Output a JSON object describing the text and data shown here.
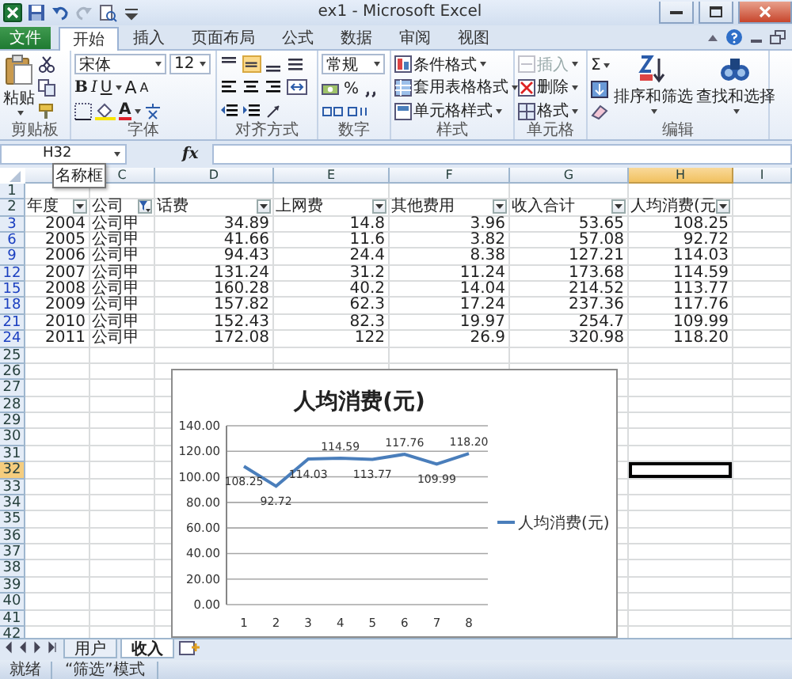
{
  "window": {
    "title": "ex1 - Microsoft Excel"
  },
  "ribbon_tabs": [
    {
      "label": "文件",
      "kind": "file",
      "selected": false
    },
    {
      "label": "开始",
      "kind": "tab",
      "selected": true
    },
    {
      "label": "插入",
      "kind": "tab",
      "selected": false
    },
    {
      "label": "页面布局",
      "kind": "tab",
      "selected": false
    },
    {
      "label": "公式",
      "kind": "tab",
      "selected": false
    },
    {
      "label": "数据",
      "kind": "tab",
      "selected": false
    },
    {
      "label": "审阅",
      "kind": "tab",
      "selected": false
    },
    {
      "label": "视图",
      "kind": "tab",
      "selected": false
    }
  ],
  "ribbon_groups": [
    {
      "kind": "clipboard",
      "label": "剪贴板",
      "paste": "粘贴"
    },
    {
      "kind": "font",
      "label": "字体",
      "font_name": "宋体",
      "font_size": "12",
      "style_buttons": [
        "B",
        "I",
        "U"
      ],
      "size_buttons": [
        "A",
        "A"
      ],
      "color_button": "A"
    },
    {
      "kind": "alignment",
      "label": "对齐方式"
    },
    {
      "kind": "number",
      "label": "数字",
      "format": "常规",
      "percent": "%"
    },
    {
      "kind": "styles",
      "label": "样式",
      "items": [
        "条件格式",
        "套用表格格式",
        "单元格样式"
      ]
    },
    {
      "kind": "cells",
      "label": "单元格",
      "items": [
        {
          "label": "插入",
          "disabled": true
        },
        {
          "label": "删除",
          "disabled": false
        },
        {
          "label": "格式",
          "disabled": false
        }
      ]
    },
    {
      "kind": "editing",
      "label": "编辑",
      "sum": "Σ",
      "items": [
        "排序和筛选",
        "查找和选择"
      ]
    }
  ],
  "formula_bar": {
    "name_box": "H32",
    "tooltip": "名称框",
    "fx": "fx"
  },
  "sheet": {
    "columns": [
      {
        "selected": false
      },
      {
        "label": "C",
        "selected": false
      },
      {
        "label": "D",
        "selected": false
      },
      {
        "label": "E",
        "selected": false
      },
      {
        "label": "F",
        "selected": false
      },
      {
        "label": "G",
        "selected": false
      },
      {
        "label": "H",
        "selected": true
      },
      {
        "label": "I",
        "selected": false
      }
    ],
    "rows": [
      {
        "number": "1",
        "kind": "blank",
        "filtered": false,
        "selected": false
      },
      {
        "number": "2",
        "kind": "header",
        "filtered": false,
        "selected": false,
        "cells": [
          {
            "text": "年度",
            "filter_applied": false
          },
          {
            "text": "公司",
            "filter_applied": true
          },
          {
            "text": "话费",
            "filter_applied": false
          },
          {
            "text": "上网费",
            "filter_applied": false
          },
          {
            "text": "其他费用",
            "filter_applied": false
          },
          {
            "text": "收入合计",
            "filter_applied": false
          },
          {
            "text": "人均消费(元",
            "filter_applied": false
          }
        ]
      },
      {
        "number": "3",
        "kind": "data",
        "filtered": true,
        "selected": false,
        "cells": [
          "2004",
          "公司甲",
          "34.89",
          "14.8",
          "3.96",
          "53.65",
          "108.25"
        ]
      },
      {
        "number": "6",
        "kind": "data",
        "filtered": true,
        "selected": false,
        "cells": [
          "2005",
          "公司甲",
          "41.66",
          "11.6",
          "3.82",
          "57.08",
          "92.72"
        ]
      },
      {
        "number": "9",
        "kind": "data",
        "filtered": true,
        "selected": false,
        "cells": [
          "2006",
          "公司甲",
          "94.43",
          "24.4",
          "8.38",
          "127.21",
          "114.03"
        ]
      },
      {
        "number": "12",
        "kind": "data",
        "filtered": true,
        "selected": false,
        "cells": [
          "2007",
          "公司甲",
          "131.24",
          "31.2",
          "11.24",
          "173.68",
          "114.59"
        ]
      },
      {
        "number": "15",
        "kind": "data",
        "filtered": true,
        "selected": false,
        "cells": [
          "2008",
          "公司甲",
          "160.28",
          "40.2",
          "14.04",
          "214.52",
          "113.77"
        ]
      },
      {
        "number": "18",
        "kind": "data",
        "filtered": true,
        "selected": false,
        "cells": [
          "2009",
          "公司甲",
          "157.82",
          "62.3",
          "17.24",
          "237.36",
          "117.76"
        ]
      },
      {
        "number": "21",
        "kind": "data",
        "filtered": true,
        "selected": false,
        "cells": [
          "2010",
          "公司甲",
          "152.43",
          "82.3",
          "19.97",
          "254.7",
          "109.99"
        ]
      },
      {
        "number": "24",
        "kind": "data",
        "filtered": true,
        "selected": false,
        "cells": [
          "2011",
          "公司甲",
          "172.08",
          "122",
          "26.9",
          "320.98",
          "118.20"
        ]
      },
      {
        "number": "25",
        "kind": "blank",
        "filtered": false,
        "selected": false
      },
      {
        "number": "26",
        "kind": "blank",
        "filtered": false,
        "selected": false
      },
      {
        "number": "27",
        "kind": "blank",
        "filtered": false,
        "selected": false
      },
      {
        "number": "28",
        "kind": "blank",
        "filtered": false,
        "selected": false
      },
      {
        "number": "29",
        "kind": "blank",
        "filtered": false,
        "selected": false
      },
      {
        "number": "30",
        "kind": "blank",
        "filtered": false,
        "selected": false
      },
      {
        "number": "31",
        "kind": "blank",
        "filtered": false,
        "selected": false
      },
      {
        "number": "32",
        "kind": "blank",
        "filtered": false,
        "selected": true
      },
      {
        "number": "33",
        "kind": "blank",
        "filtered": false,
        "selected": false
      },
      {
        "number": "34",
        "kind": "blank",
        "filtered": false,
        "selected": false
      },
      {
        "number": "35",
        "kind": "blank",
        "filtered": false,
        "selected": false
      },
      {
        "number": "36",
        "kind": "blank",
        "filtered": false,
        "selected": false
      },
      {
        "number": "37",
        "kind": "blank",
        "filtered": false,
        "selected": false
      },
      {
        "number": "38",
        "kind": "blank",
        "filtered": false,
        "selected": false
      },
      {
        "number": "39",
        "kind": "blank",
        "filtered": false,
        "selected": false
      },
      {
        "number": "40",
        "kind": "blank",
        "filtered": false,
        "selected": false
      },
      {
        "number": "41",
        "kind": "blank",
        "filtered": false,
        "selected": false
      },
      {
        "number": "42",
        "kind": "blank",
        "filtered": false,
        "selected": false
      }
    ]
  },
  "chart": {
    "chart_data": {
      "type": "line",
      "title": "人均消费(元)",
      "categories": [
        "1",
        "2",
        "3",
        "4",
        "5",
        "6",
        "7",
        "8"
      ],
      "series": [
        {
          "name": "人均消费(元)",
          "color": "#4a7ebb",
          "values": [
            108.25,
            92.72,
            114.03,
            114.59,
            113.77,
            117.76,
            109.99,
            118.2
          ]
        }
      ],
      "ylim": [
        0,
        140
      ],
      "yticks": [
        {
          "value": 0,
          "label": "0.00"
        },
        {
          "value": 20,
          "label": "20.00"
        },
        {
          "value": 40,
          "label": "40.00"
        },
        {
          "value": 60,
          "label": "60.00"
        },
        {
          "value": 80,
          "label": "80.00"
        },
        {
          "value": 100,
          "label": "100.00"
        },
        {
          "value": 120,
          "label": "120.00"
        },
        {
          "value": 140,
          "label": "140.00"
        }
      ],
      "grid": true,
      "value_labels": [
        "108.25",
        "92.72",
        "114.03",
        "114.59",
        "113.77",
        "117.76",
        "109.99",
        "118.20"
      ]
    }
  },
  "sheet_tabs": [
    {
      "label": "用户",
      "selected": false
    },
    {
      "label": "收入",
      "selected": true
    }
  ],
  "status_bar": {
    "ready": "就绪",
    "mode": "“筛选”模式"
  }
}
